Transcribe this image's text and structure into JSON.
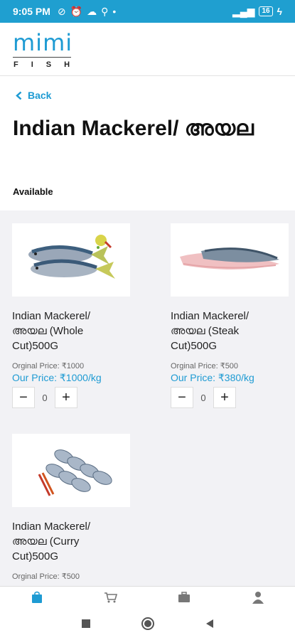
{
  "status": {
    "time": "9:05 PM",
    "battery": "16"
  },
  "brand": {
    "logo_top": "mimi",
    "logo_bottom": "FISH"
  },
  "nav": {
    "back_label": "Back"
  },
  "page": {
    "title": "Indian Mackerel/ അയല",
    "availability": "Available"
  },
  "products": [
    {
      "name": "Indian Mackerel/ അയല (Whole Cut)500G",
      "original_price": "Orginal Price: ₹1000",
      "our_price": "Our Price: ₹1000/kg",
      "quantity": "0"
    },
    {
      "name": "Indian Mackerel/ അയല (Steak Cut)500G",
      "original_price": "Orginal Price: ₹500",
      "our_price": "Our Price: ₹380/kg",
      "quantity": "0"
    },
    {
      "name": "Indian Mackerel/ അയല (Curry Cut)500G",
      "original_price": "Orginal Price: ₹500"
    }
  ],
  "colors": {
    "accent": "#1e9bd3",
    "statusbar": "#1f9fd0",
    "grid_bg": "#f2f2f5"
  },
  "bottom_nav": {
    "items": [
      "shopping-bag-icon",
      "cart-icon",
      "orders-icon",
      "profile-icon"
    ],
    "active": "shopping-bag-icon"
  }
}
